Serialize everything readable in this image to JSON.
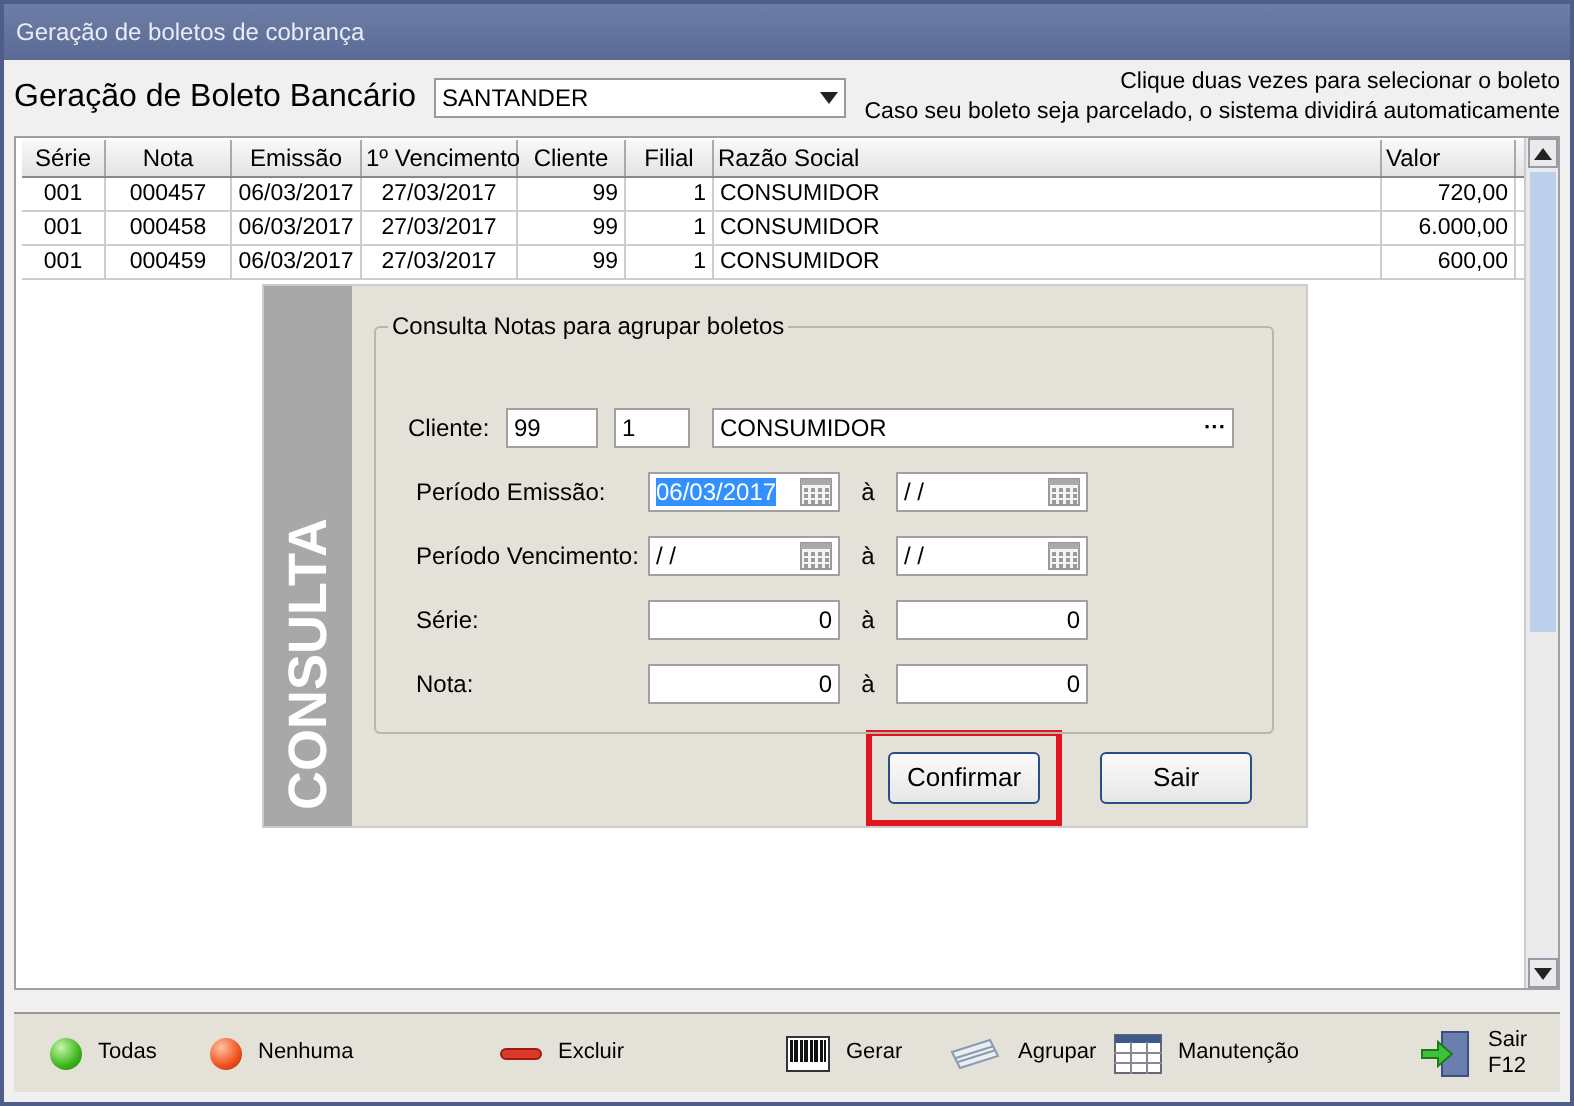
{
  "window": {
    "title": "Geração de boletos de cobrança"
  },
  "header": {
    "title": "Geração de Boleto Bancário",
    "bank": "SANTANDER",
    "hints": [
      "Clique duas vezes para selecionar o boleto",
      "Caso seu boleto seja parcelado, o sistema dividirá automaticamente"
    ]
  },
  "table": {
    "columns": [
      "Série",
      "Nota",
      "Emissão",
      "1º Vencimento",
      "Cliente",
      "Filial",
      "Razão Social",
      "Valor"
    ],
    "rows": [
      [
        "001",
        "000457",
        "06/03/2017",
        "27/03/2017",
        "99",
        "1",
        "CONSUMIDOR",
        "720,00"
      ],
      [
        "001",
        "000458",
        "06/03/2017",
        "27/03/2017",
        "99",
        "1",
        "CONSUMIDOR",
        "6.000,00"
      ],
      [
        "001",
        "000459",
        "06/03/2017",
        "27/03/2017",
        "99",
        "1",
        "CONSUMIDOR",
        "600,00"
      ]
    ]
  },
  "dialog": {
    "side_label": "CONSULTA",
    "group_title": "Consulta Notas para agrupar boletos",
    "client": {
      "label": "Cliente:",
      "code": "99",
      "branch": "1",
      "name": "CONSUMIDOR",
      "lookup": "···"
    },
    "ranges": [
      {
        "label": "Período Emissão:",
        "kind": "date",
        "from": "06/03/2017",
        "from_selected": true,
        "sep": "à",
        "to": "/ /"
      },
      {
        "label": "Período Vencimento:",
        "kind": "date",
        "from": "/ /",
        "from_selected": false,
        "sep": "à",
        "to": "/ /"
      },
      {
        "label": "Série:",
        "kind": "number",
        "from": "0",
        "from_selected": false,
        "sep": "à",
        "to": "0"
      },
      {
        "label": "Nota:",
        "kind": "number",
        "from": "0",
        "from_selected": false,
        "sep": "à",
        "to": "0"
      }
    ],
    "buttons": [
      {
        "label": "Confirmar",
        "highlighted": true
      },
      {
        "label": "Sair",
        "highlighted": false
      }
    ]
  },
  "footer": {
    "actions": [
      {
        "kind": "green",
        "lines": [
          "Todas"
        ]
      },
      {
        "kind": "red",
        "lines": [
          "Nenhuma"
        ]
      },
      {
        "kind": "delete",
        "lines": [
          "Excluir"
        ]
      },
      {
        "kind": "barcode",
        "lines": [
          "Gerar"
        ]
      },
      {
        "kind": "group",
        "lines": [
          "Agrupar"
        ]
      },
      {
        "kind": "table",
        "lines": [
          "Manutenção"
        ]
      },
      {
        "kind": "exit",
        "lines": [
          "Sair",
          "F12"
        ]
      }
    ]
  }
}
